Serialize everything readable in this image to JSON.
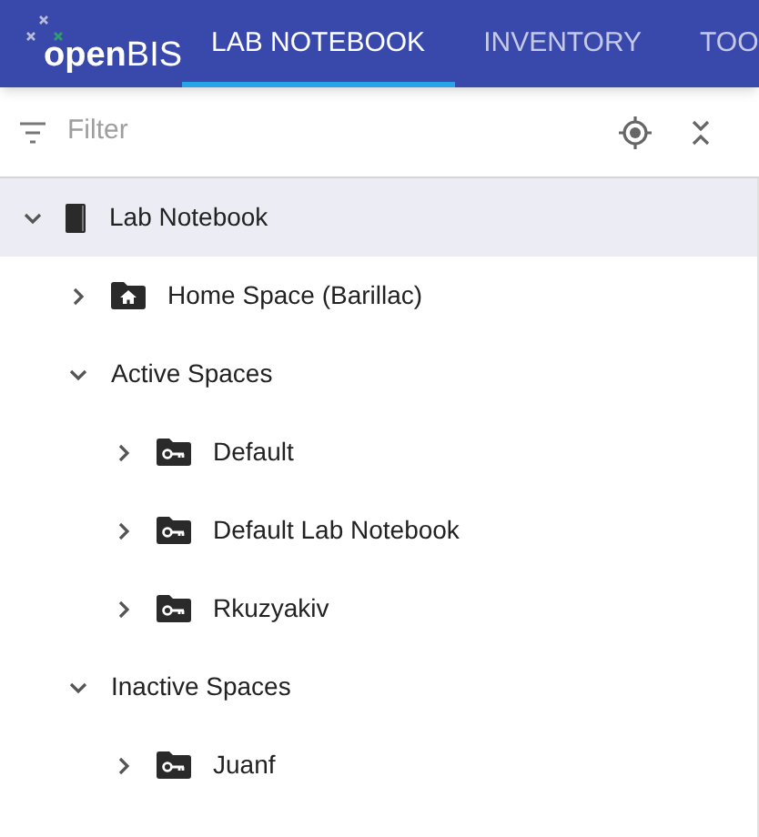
{
  "logo": {
    "text": "**open**BIS"
  },
  "tabs": [
    {
      "label": "LAB NOTEBOOK",
      "selected": true
    },
    {
      "label": "INVENTORY",
      "selected": false
    },
    {
      "label": "TOO",
      "selected": false
    }
  ],
  "filter": {
    "placeholder": "Filter"
  },
  "tree": [
    {
      "label": "Lab Notebook",
      "kind": "notebook",
      "expanded": true,
      "selected": true,
      "children": [
        {
          "label": "Home Space (Barillac)",
          "kind": "home",
          "expanded": false,
          "selected": false
        },
        {
          "label": "Active Spaces",
          "kind": "group",
          "expanded": true,
          "selected": false,
          "children": [
            {
              "label": "Default",
              "kind": "space",
              "expanded": false,
              "selected": false
            },
            {
              "label": "Default Lab Notebook",
              "kind": "space",
              "expanded": false,
              "selected": false
            },
            {
              "label": "Rkuzyakiv",
              "kind": "space",
              "expanded": false,
              "selected": false
            }
          ]
        },
        {
          "label": "Inactive Spaces",
          "kind": "group",
          "expanded": true,
          "selected": false,
          "children": [
            {
              "label": "Juanf",
              "kind": "space",
              "expanded": false,
              "selected": false
            }
          ]
        }
      ]
    }
  ]
}
